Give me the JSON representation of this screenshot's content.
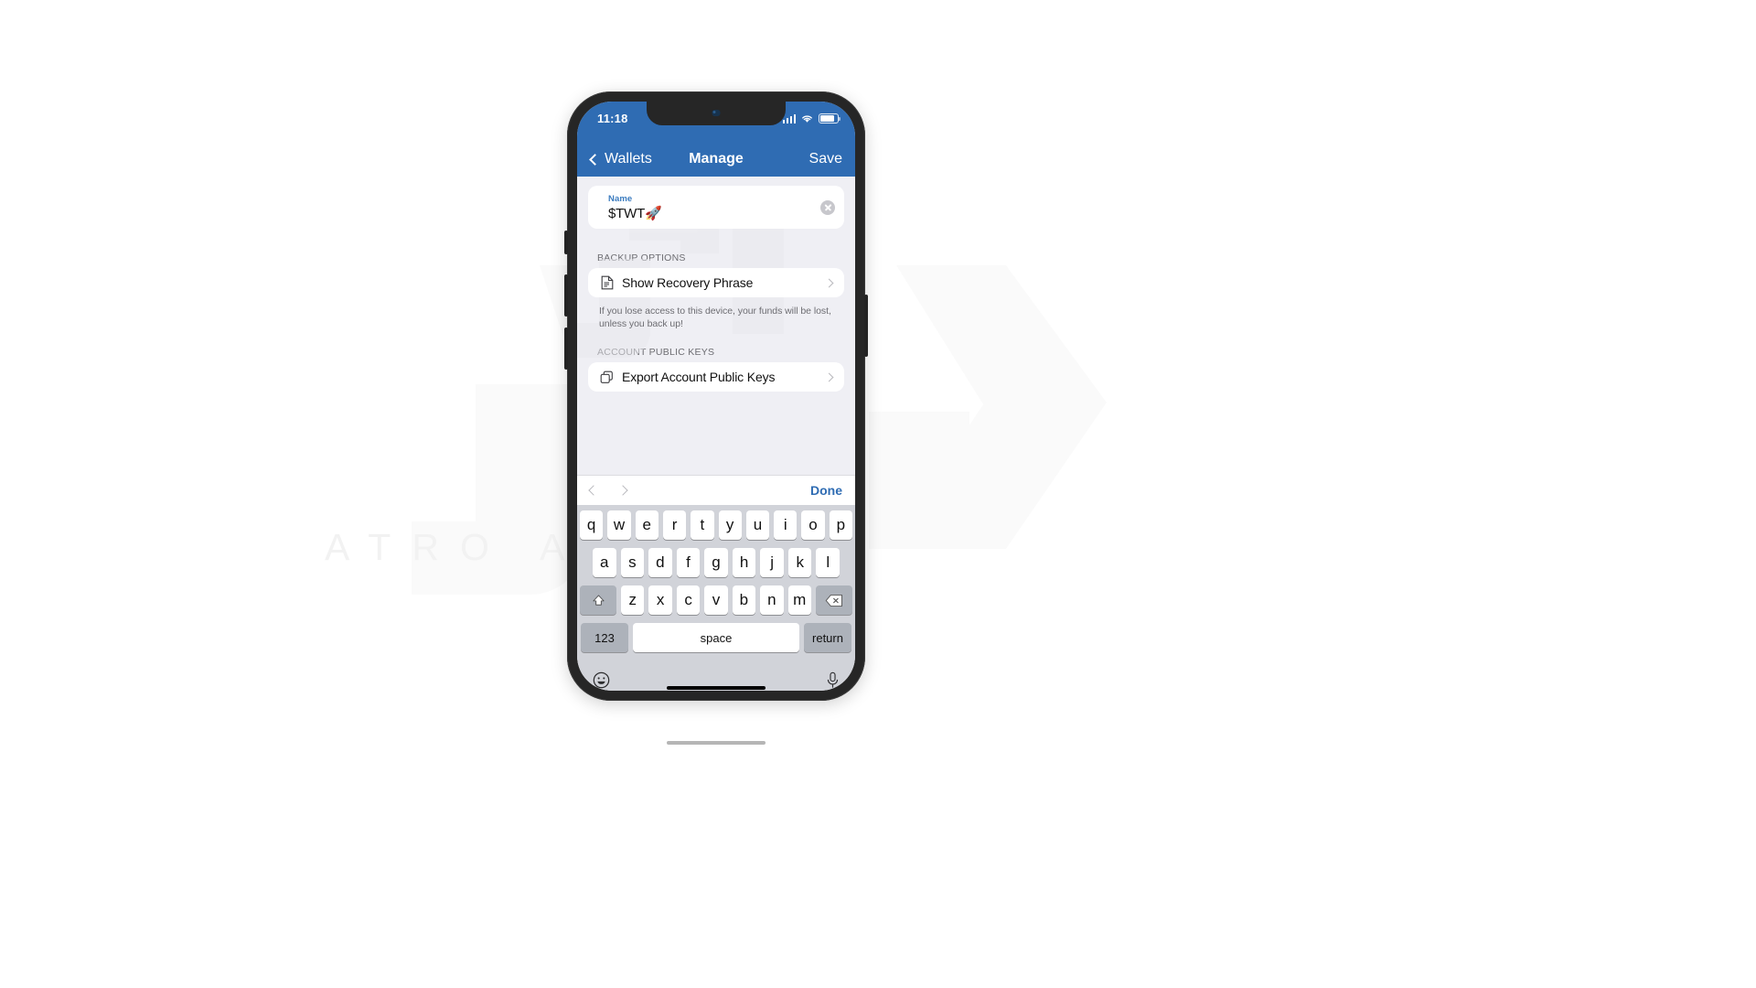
{
  "window": {
    "background_color": "#ffffff"
  },
  "watermark": {
    "subtitle": "ATRO AG"
  },
  "phone": {
    "status_bar": {
      "time": "11:18",
      "signal_icon": "cellular-signal-icon",
      "wifi_icon": "wifi-icon",
      "battery_icon": "battery-icon",
      "background_color": "#2f6cb3"
    },
    "nav_bar": {
      "back_label": "Wallets",
      "back_icon": "chevron-left-icon",
      "title": "Manage",
      "save_label": "Save",
      "background_color": "#2f6cb3"
    },
    "form": {
      "name_field": {
        "label": "Name",
        "value": "$TWT🚀",
        "clear_icon": "clear-circle-icon"
      },
      "sections": [
        {
          "title": "BACKUP OPTIONS",
          "rows": [
            {
              "icon": "document-icon",
              "label": "Show Recovery Phrase",
              "chevron": "chevron-right-icon"
            }
          ],
          "footer": "If you lose access to this device, your funds will be lost, unless you back up!"
        },
        {
          "title": "ACCOUNT PUBLIC KEYS",
          "rows": [
            {
              "icon": "copy-icon",
              "label": "Export Account Public Keys",
              "chevron": "chevron-right-icon"
            }
          ],
          "footer": ""
        }
      ]
    },
    "accessory_bar": {
      "prev_icon": "chevron-left-icon",
      "next_icon": "chevron-right-icon",
      "done_label": "Done",
      "done_color": "#2f6cb3"
    },
    "keyboard": {
      "row1": [
        "q",
        "w",
        "e",
        "r",
        "t",
        "y",
        "u",
        "i",
        "o",
        "p"
      ],
      "row2": [
        "a",
        "s",
        "d",
        "f",
        "g",
        "h",
        "j",
        "k",
        "l"
      ],
      "row3": [
        "z",
        "x",
        "c",
        "v",
        "b",
        "n",
        "m"
      ],
      "shift_icon": "shift-arrow-icon",
      "backspace_icon": "backspace-icon",
      "numbers_label": "123",
      "space_label": "space",
      "return_label": "return",
      "emoji_icon": "emoji-smiley-icon",
      "mic_icon": "microphone-icon",
      "background_color": "#d1d3d9"
    }
  }
}
